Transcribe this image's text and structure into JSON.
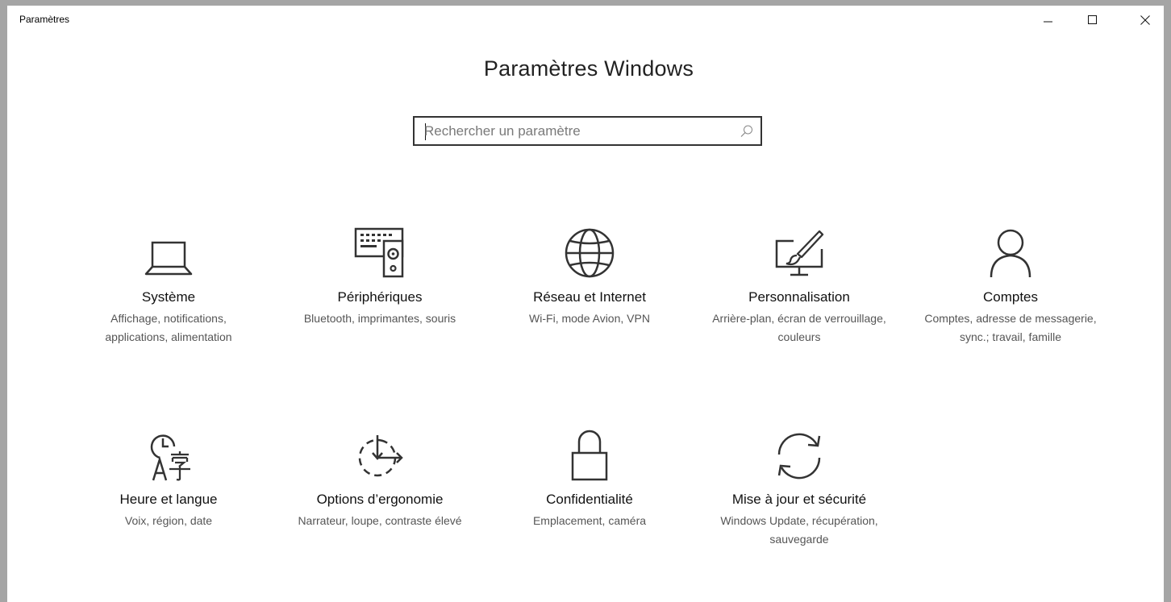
{
  "window": {
    "title": "Paramètres",
    "controls": {
      "minimize_icon": "minimize-icon",
      "maximize_icon": "maximize-icon",
      "close_icon": "close-icon"
    }
  },
  "header": {
    "title": "Paramètres Windows"
  },
  "search": {
    "placeholder": "Rechercher un paramètre",
    "value": "",
    "icon": "search-icon"
  },
  "categories": [
    {
      "label": "Système",
      "desc": "Affichage, notifications, applications, alimentation",
      "icon": "laptop-icon"
    },
    {
      "label": "Périphériques",
      "desc": "Bluetooth, imprimantes, souris",
      "icon": "keyboard-speaker-icon"
    },
    {
      "label": "Réseau et Internet",
      "desc": "Wi-Fi, mode Avion, VPN",
      "icon": "globe-icon"
    },
    {
      "label": "Personnalisation",
      "desc": "Arrière-plan, écran de verrouillage, couleurs",
      "icon": "paint-monitor-icon"
    },
    {
      "label": "Comptes",
      "desc": "Comptes, adresse de messagerie, sync.; travail, famille",
      "icon": "person-icon"
    },
    {
      "label": "Heure et langue",
      "desc": "Voix, région, date",
      "icon": "clock-language-icon"
    },
    {
      "label": "Options d’ergonomie",
      "desc": "Narrateur, loupe, contraste élevé",
      "icon": "ease-of-access-icon"
    },
    {
      "label": "Confidentialité",
      "desc": "Emplacement, caméra",
      "icon": "lock-icon"
    },
    {
      "label": "Mise à jour et sécurité",
      "desc": "Windows Update, récupération, sauvegarde",
      "icon": "sync-arrows-icon"
    }
  ],
  "colors": {
    "background_frame": "#a5a5a5",
    "window": "#ffffff",
    "text": "#111111",
    "secondary_text": "#555555",
    "icon_stroke": "#333333"
  }
}
